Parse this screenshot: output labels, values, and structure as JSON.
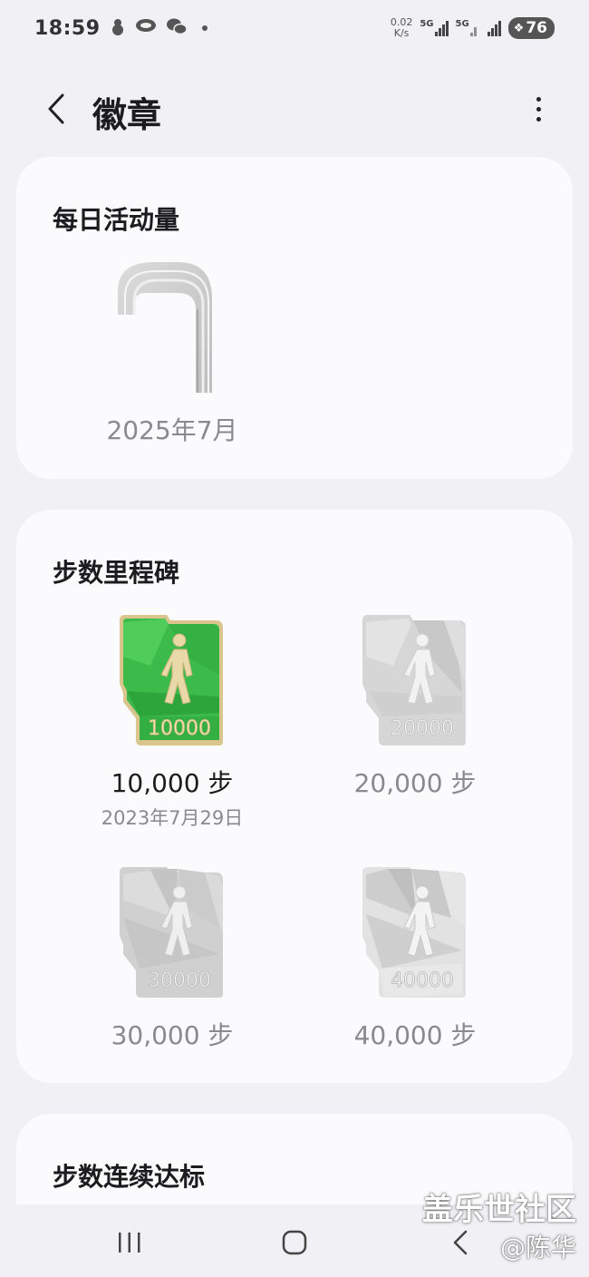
{
  "status_bar": {
    "time": "18:59",
    "net_speed_value": "0.02",
    "net_speed_unit": "K/s",
    "sim1_label": "5G",
    "sim2_label": "5G",
    "battery": "76"
  },
  "header": {
    "title": "徽章"
  },
  "daily_activity": {
    "title": "每日活动量",
    "badges": [
      {
        "label": "2025年7月"
      }
    ]
  },
  "step_milestones": {
    "title": "步数里程碑",
    "badges": [
      {
        "badge_number": "10000",
        "label": "10,000 步",
        "date": "2023年7月29日",
        "earned": true
      },
      {
        "badge_number": "20000",
        "label": "20,000 步",
        "earned": false
      },
      {
        "badge_number": "30000",
        "label": "30,000 步",
        "earned": false
      },
      {
        "badge_number": "40000",
        "label": "40,000 步",
        "earned": false
      }
    ]
  },
  "step_streak": {
    "title": "步数连续达标"
  },
  "watermark": {
    "line1": "盖乐世社区",
    "line2": "@陈华"
  },
  "colors": {
    "background": "#f1f1f5",
    "card": "#fbfbfd",
    "earned_green": "#3dbb4a",
    "gold": "#d8c48a",
    "unearned_gray": "#c9c9c9"
  }
}
